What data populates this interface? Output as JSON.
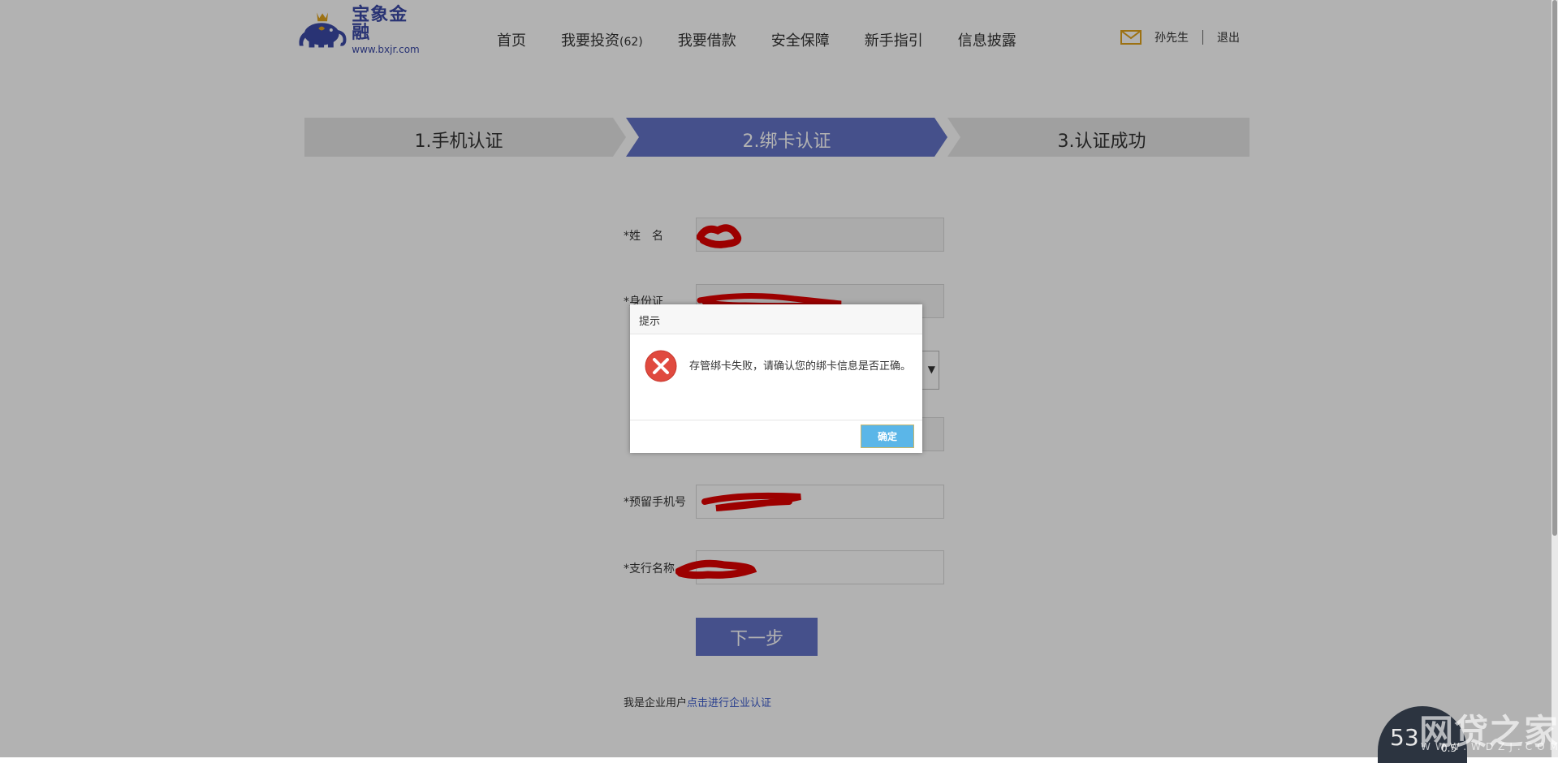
{
  "header": {
    "logo_name": "宝象金融",
    "logo_url": "www.bxjr.com",
    "nav": [
      {
        "label": "首页"
      },
      {
        "label": "我要投资",
        "count": "(62)"
      },
      {
        "label": "我要借款"
      },
      {
        "label": "安全保障"
      },
      {
        "label": "新手指引"
      },
      {
        "label": "信息披露"
      }
    ],
    "user_name": "孙先生",
    "logout": "退出"
  },
  "steps": [
    {
      "label": "1.手机认证",
      "active": false
    },
    {
      "label": "2.绑卡认证",
      "active": true
    },
    {
      "label": "3.认证成功",
      "active": false
    }
  ],
  "form": {
    "name_label": "*姓　名",
    "id_label": "*身份证",
    "phone_label": "*预留手机号",
    "branch_label": "*支行名称",
    "next_button": "下一步",
    "corp_text": "我是企业用户",
    "corp_link": "点击进行企业认证"
  },
  "dialog": {
    "title": "提示",
    "message": "存管绑卡失败，请确认您的绑卡信息是否正确。",
    "ok_button": "确定"
  },
  "widget": {
    "speed_value": "53",
    "speed_sub": "0.5",
    "watermark": "网贷之家",
    "watermark_url": "WWW.WDZJ.COM"
  },
  "colors": {
    "brand": "#3b4aa6",
    "active_step": "#6473c8",
    "inactive_step": "#e6e6e6",
    "ok_button": "#5bb6e8",
    "error_icon": "#e04a3f"
  }
}
